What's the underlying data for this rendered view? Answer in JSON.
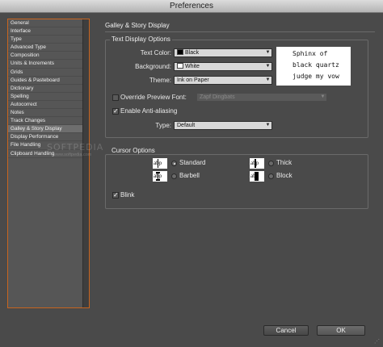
{
  "window": {
    "title": "Preferences"
  },
  "sidebar": {
    "items": [
      {
        "label": "General"
      },
      {
        "label": "Interface"
      },
      {
        "label": "Type"
      },
      {
        "label": "Advanced Type"
      },
      {
        "label": "Composition"
      },
      {
        "label": "Units & Increments"
      },
      {
        "label": "Grids"
      },
      {
        "label": "Guides & Pasteboard"
      },
      {
        "label": "Dictionary"
      },
      {
        "label": "Spelling"
      },
      {
        "label": "Autocorrect"
      },
      {
        "label": "Notes"
      },
      {
        "label": "Track Changes"
      },
      {
        "label": "Galley & Story Display",
        "selected": true
      },
      {
        "label": "Display Performance"
      },
      {
        "label": "File Handling"
      },
      {
        "label": "Clipboard Handling"
      }
    ],
    "watermark": "SOFTPEDIA",
    "watermark_url": "www.softpedia.com"
  },
  "panel": {
    "title": "Galley & Story Display",
    "text_display": {
      "group_label": "Text Display Options",
      "text_color_label": "Text Color:",
      "text_color_value": "Black",
      "text_color_swatch": "#000000",
      "background_label": "Background:",
      "background_value": "White",
      "background_swatch": "#ffffff",
      "theme_label": "Theme:",
      "theme_value": "Ink on Paper",
      "preview_lines": [
        "Sphinx of",
        "black quartz",
        "judge my vow"
      ],
      "override_font_label": "Override Preview Font:",
      "override_font_checked": false,
      "override_font_value": "Zapf Dingbats",
      "anti_alias_label": "Enable Anti-aliasing",
      "anti_alias_checked": true,
      "type_label": "Type:",
      "type_value": "Default"
    },
    "cursor": {
      "group_label": "Cursor Options",
      "icon_text": "abp",
      "options": {
        "standard": {
          "label": "Standard",
          "selected": true
        },
        "barbell": {
          "label": "Barbell",
          "selected": false
        },
        "thick": {
          "label": "Thick",
          "selected": false
        },
        "block": {
          "label": "Block",
          "selected": false
        }
      },
      "blink_label": "Blink",
      "blink_checked": true
    }
  },
  "footer": {
    "cancel_label": "Cancel",
    "ok_label": "OK"
  },
  "colors": {
    "selection_border": "#c8641e",
    "window_bg": "#4a4a4a"
  }
}
